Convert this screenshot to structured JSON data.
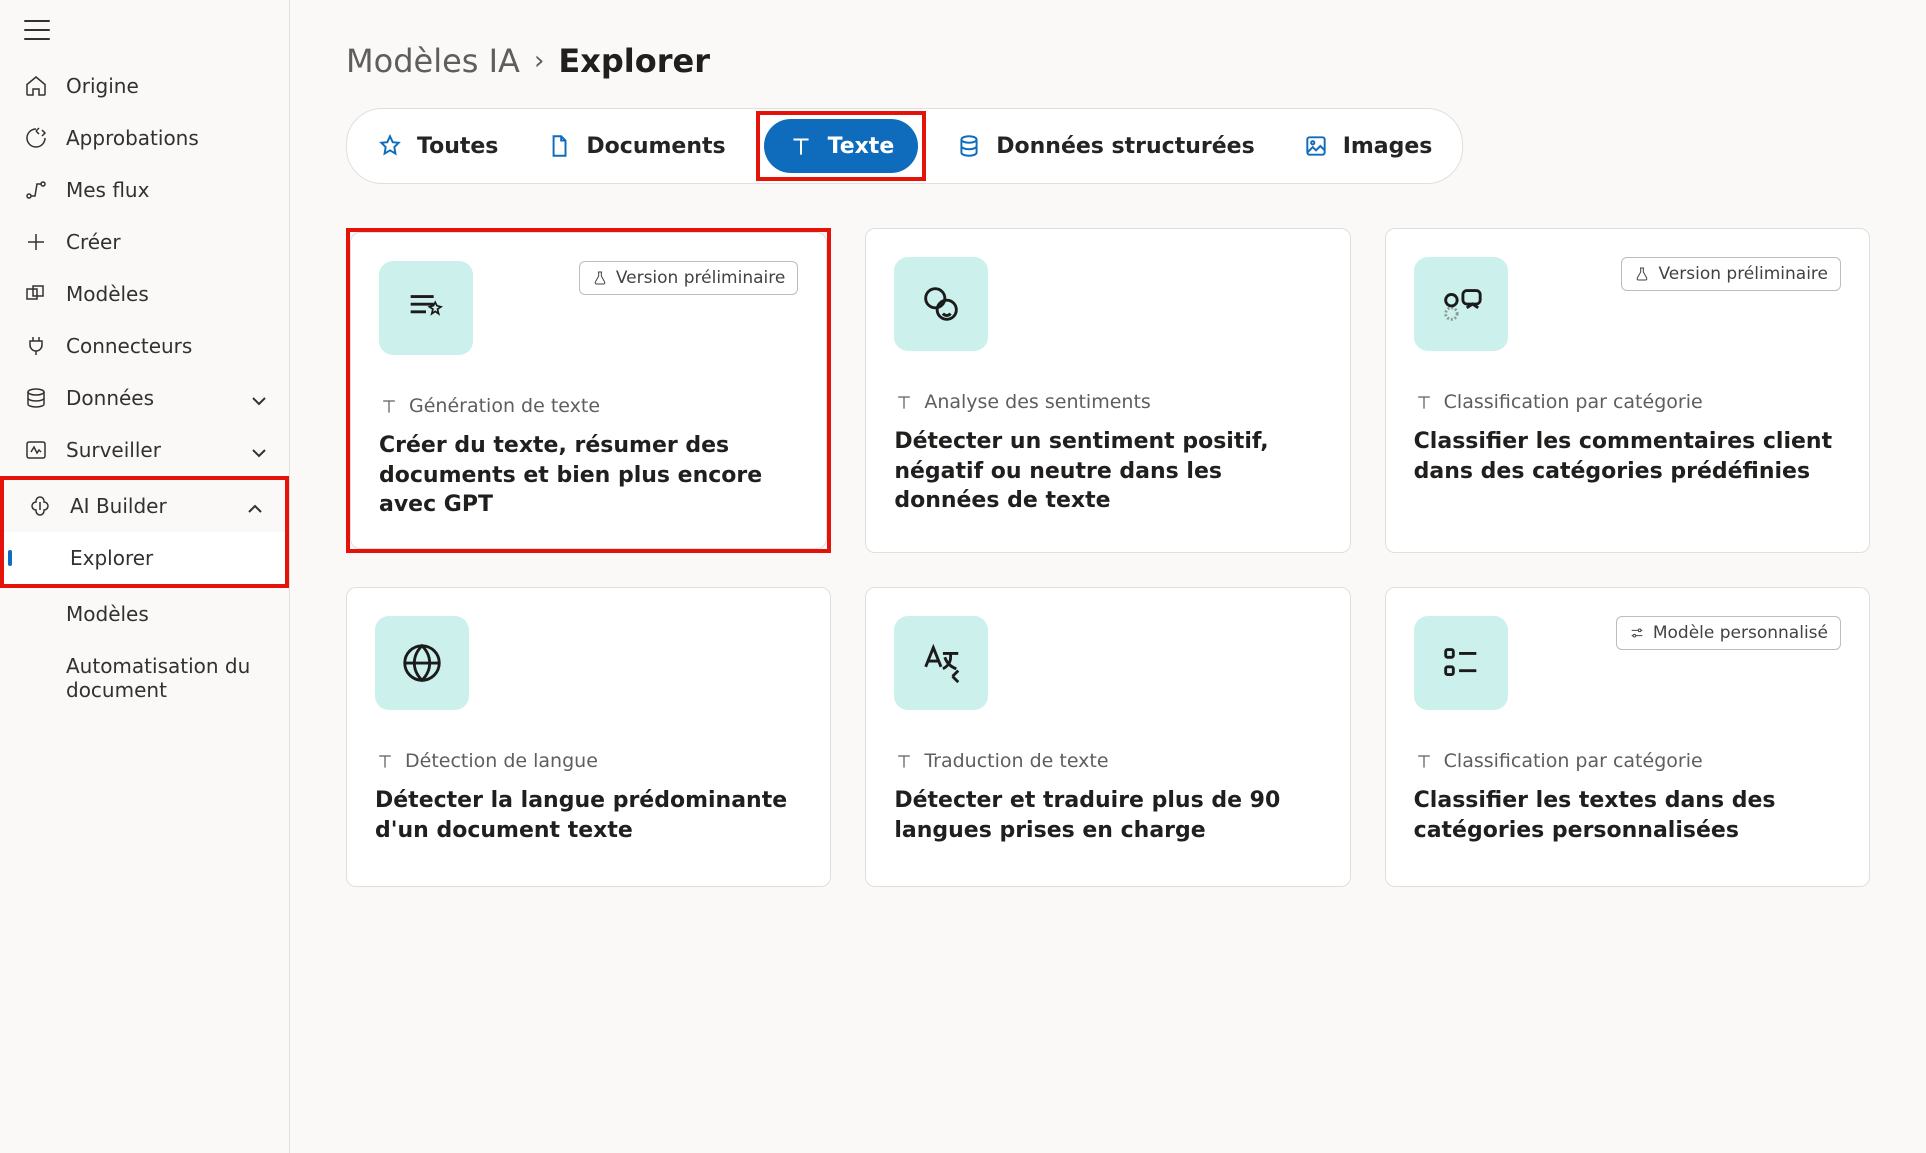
{
  "sidebar": {
    "items": [
      {
        "label": "Origine"
      },
      {
        "label": "Approbations"
      },
      {
        "label": "Mes flux"
      },
      {
        "label": "Créer"
      },
      {
        "label": "Modèles"
      },
      {
        "label": "Connecteurs"
      },
      {
        "label": "Données"
      },
      {
        "label": "Surveiller"
      },
      {
        "label": "AI Builder"
      }
    ],
    "aiSub": [
      {
        "label": "Explorer"
      },
      {
        "label": "Modèles"
      },
      {
        "label": "Automatisation du document"
      }
    ]
  },
  "breadcrumb": {
    "root": "Modèles IA",
    "current": "Explorer"
  },
  "filters": [
    {
      "label": "Toutes"
    },
    {
      "label": "Documents"
    },
    {
      "label": "Texte"
    },
    {
      "label": "Données structurées"
    },
    {
      "label": "Images"
    }
  ],
  "badges": {
    "preview": "Version préliminaire",
    "custom": "Modèle personnalisé"
  },
  "cards": [
    {
      "category": "Génération de texte",
      "title": "Créer du texte, résumer des documents et bien plus encore avec GPT",
      "badge": "preview"
    },
    {
      "category": "Analyse des sentiments",
      "title": "Détecter un sentiment positif, négatif ou neutre dans les données de texte",
      "badge": null
    },
    {
      "category": "Classification par catégorie",
      "title": "Classifier les commentaires client dans des catégories prédéfinies",
      "badge": "preview"
    },
    {
      "category": "Détection de langue",
      "title": "Détecter la langue prédominante d'un document texte",
      "badge": null
    },
    {
      "category": "Traduction de texte",
      "title": "Détecter et traduire plus de 90 langues prises en charge",
      "badge": null
    },
    {
      "category": "Classification par catégorie",
      "title": "Classifier les textes dans des catégories personnalisées",
      "badge": "custom"
    }
  ]
}
